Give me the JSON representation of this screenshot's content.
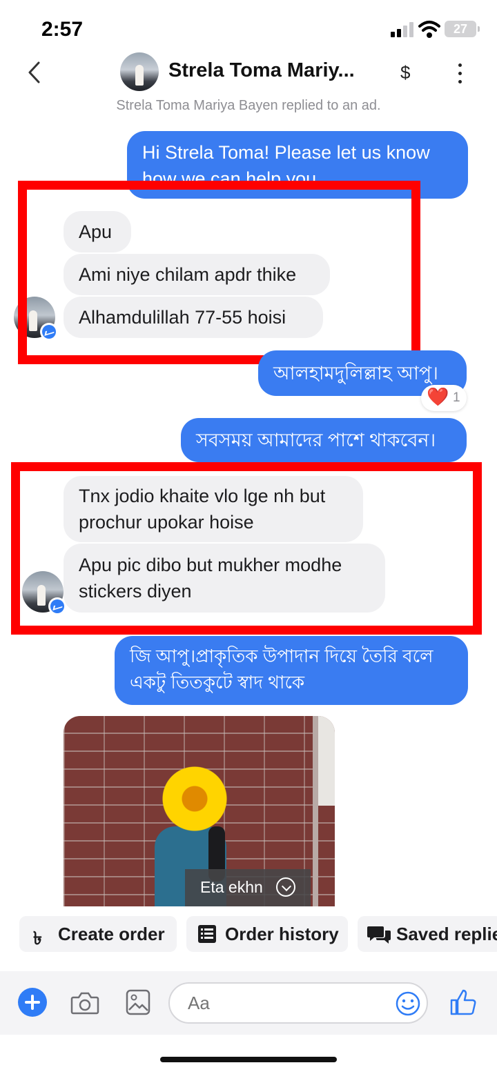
{
  "status": {
    "time": "2:57",
    "battery": "27"
  },
  "header": {
    "title": "Strela Toma Mariy...",
    "pay_icon": "$"
  },
  "context_note": "Strela Toma Mariya Bayen replied to an ad.",
  "messages": [
    {
      "dir": "out",
      "lines": [
        "Hi Strela Toma! Please let us know",
        "how we can help you"
      ]
    },
    {
      "dir": "in",
      "text": "Apu"
    },
    {
      "dir": "in",
      "text": "Ami niye chilam apdr thike"
    },
    {
      "dir": "in",
      "text": "Alhamdulillah 77-55 hoisi"
    },
    {
      "dir": "out",
      "text": "আলহামদুলিল্লাহ আপু।",
      "reaction": {
        "emoji": "❤️",
        "count": "1"
      }
    },
    {
      "dir": "out",
      "text": "সবসময় আমাদের পাশে থাকবেন।"
    },
    {
      "dir": "in",
      "lines": [
        "Tnx jodio khaite vlo lge nh but",
        "prochur upokar hoise"
      ]
    },
    {
      "dir": "in",
      "lines": [
        "Apu pic dibo but mukher modhe",
        "stickers diyen"
      ]
    },
    {
      "dir": "out",
      "lines": [
        "জি আপু।প্রাকৃতিক উপাদান দিয়ে তৈরি বলে",
        "একটু তিতকুটে স্বাদ থাকে"
      ]
    }
  ],
  "photo_caption": "Eta ekhn",
  "actions": {
    "create_order": "Create order",
    "order_history": "Order history",
    "saved_replies": "Saved replie"
  },
  "composer": {
    "placeholder": "Aa"
  },
  "colors": {
    "outgoing": "#3a7cf1",
    "incoming": "#f0f0f2",
    "highlight": "#ff0000"
  },
  "icons": [
    "back-icon",
    "dollar-icon",
    "more-icon",
    "messenger-icon",
    "plus-icon",
    "camera-icon",
    "gallery-icon",
    "emoji-icon",
    "thumbs-up-icon",
    "taka-icon",
    "list-icon",
    "chat-bubbles-icon",
    "chevron-down-icon",
    "heart-icon"
  ]
}
